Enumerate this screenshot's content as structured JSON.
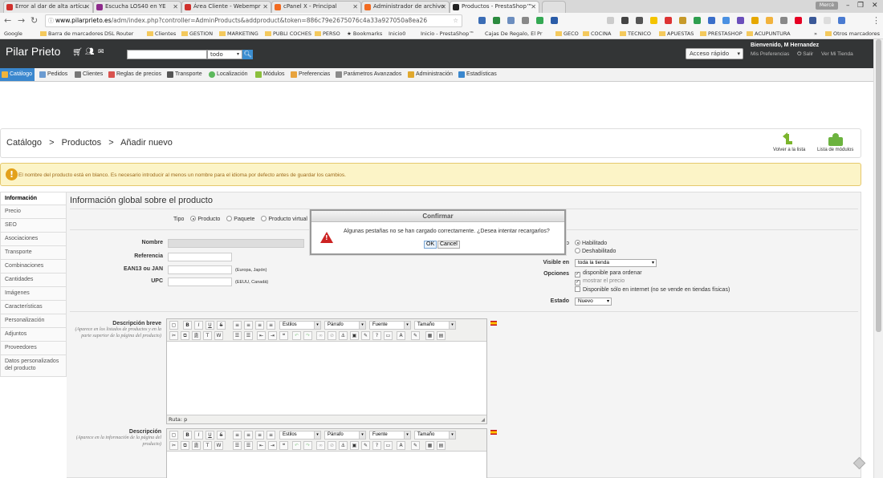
{
  "browser": {
    "tabs": [
      {
        "label": "Error al dar de alta artícu",
        "icon_color": "#d0312d"
      },
      {
        "label": "Escucha LOS40 en YE",
        "icon_color": "#8e2b8c"
      },
      {
        "label": "Área Cliente - Webempr",
        "icon_color": "#d0312d"
      },
      {
        "label": "cPanel X - Principal",
        "icon_color": "#f26b21"
      },
      {
        "label": "Administrador de archivo",
        "icon_color": "#f26b21"
      },
      {
        "label": "Productos - PrestaShop™",
        "icon_color": "#222222"
      }
    ],
    "url_domain": "www.pilarprieto.es",
    "url_path": "/adm/index.php?controller=AdminProducts&addproduct&token=886c79e2675076c4a33a927050a8ea26",
    "window_user": "Mercè",
    "bookmarks": [
      "Google",
      "Barra de marcadores",
      "DSL Router",
      "Clientes",
      "GESTION",
      "MARKETING",
      "PUBLI COCHES",
      "PERSO",
      "Bookmarks",
      "Inicio0",
      "Inicio - PrestaShop™",
      "Cajas De Regalo, El Pr",
      "GECO",
      "COCINA",
      "TECNICO",
      "APUESTAS",
      "PRESTASHOP",
      "ACUPUNTURA"
    ],
    "bookmarks_more": "»",
    "bookmarks_other": "Otros marcadores"
  },
  "header": {
    "logo": "Pilar Prieto",
    "search_scope": "todo",
    "quick_access": "Acceso rápido",
    "welcome": "Bienvenido, M Hernandez",
    "my_prefs": "Mis Preferencias",
    "logout": "Salir",
    "view_store": "Ver Mi Tienda"
  },
  "menu": [
    {
      "label": "Catálogo",
      "active": true,
      "color": "#f0b43a"
    },
    {
      "label": "Pedidos",
      "color": "#6b9bd1"
    },
    {
      "label": "Clientes",
      "color": "#777777"
    },
    {
      "label": "Reglas de precios",
      "color": "#d9534f"
    },
    {
      "label": "Transporte",
      "color": "#555555"
    },
    {
      "label": "Localización",
      "color": "#5cb85c"
    },
    {
      "label": "Módulos",
      "color": "#8bbf3c"
    },
    {
      "label": "Preferencias",
      "color": "#e8a33d"
    },
    {
      "label": "Parámetros Avanzados",
      "color": "#8a8a8a"
    },
    {
      "label": "Administración",
      "color": "#e0a82e"
    },
    {
      "label": "Estadísticas",
      "color": "#3a87ce"
    }
  ],
  "breadcrumb": {
    "a": "Catálogo",
    "b": "Productos",
    "c": "Añadir nuevo",
    "sep": ">"
  },
  "toolbar": {
    "back": "Volver a la lista",
    "modules": "Lista de módulos"
  },
  "warning": "El nombre del producto está en blanco. Es necesario introducir al menos un nombre para el idioma por defecto antes de guardar los cambios.",
  "left_tabs": [
    "Información",
    "Precio",
    "SEO",
    "Asociaciones",
    "Transporte",
    "Combinaciones",
    "Cantidades",
    "Imágenes",
    "Características",
    "Personalización",
    "Adjuntos",
    "Proveedores",
    "Datos personalizados del producto"
  ],
  "form": {
    "title": "Información global sobre el producto",
    "type_label": "Tipo",
    "type_options": [
      "Producto",
      "Paquete",
      "Producto virtual"
    ],
    "name_label": "Nombre",
    "reference_label": "Referencia",
    "ean_label": "EAN13 ou JAN",
    "ean_hint": "(Europa, Japón)",
    "upc_label": "UPC",
    "upc_hint": "(EEUU, Canadá)",
    "status_label": "o",
    "status_options": [
      "Habilitado",
      "Deshabilitado"
    ],
    "visible_label": "Visible en",
    "visible_value": "toda la tienda",
    "options_label": "Opciones",
    "options": [
      "disponible para ordenar",
      "mostrar el precio",
      "Disponible sólo en internet (no se vende en tiendas físicas)"
    ],
    "condition_label": "Estado",
    "condition_value": "Nuevo",
    "short_desc_label": "Descripción breve",
    "short_desc_hint": "(Aparece en los listados de productos y en la parte superior de la página del producto)",
    "desc_label": "Descripción",
    "desc_hint": "(Aparece en la información de la página del producto)",
    "editor_status": "Ruta: p",
    "editor_styles": "Estilos",
    "editor_para": "Párrafo",
    "editor_font": "Fuente",
    "editor_size": "Tamaño"
  },
  "dialog": {
    "title": "Confirmar",
    "message": "Algunas pestañas no se han cargado correctamente. ¿Desea intentar recargarlos?",
    "ok": "OK",
    "cancel": "Cancel"
  }
}
